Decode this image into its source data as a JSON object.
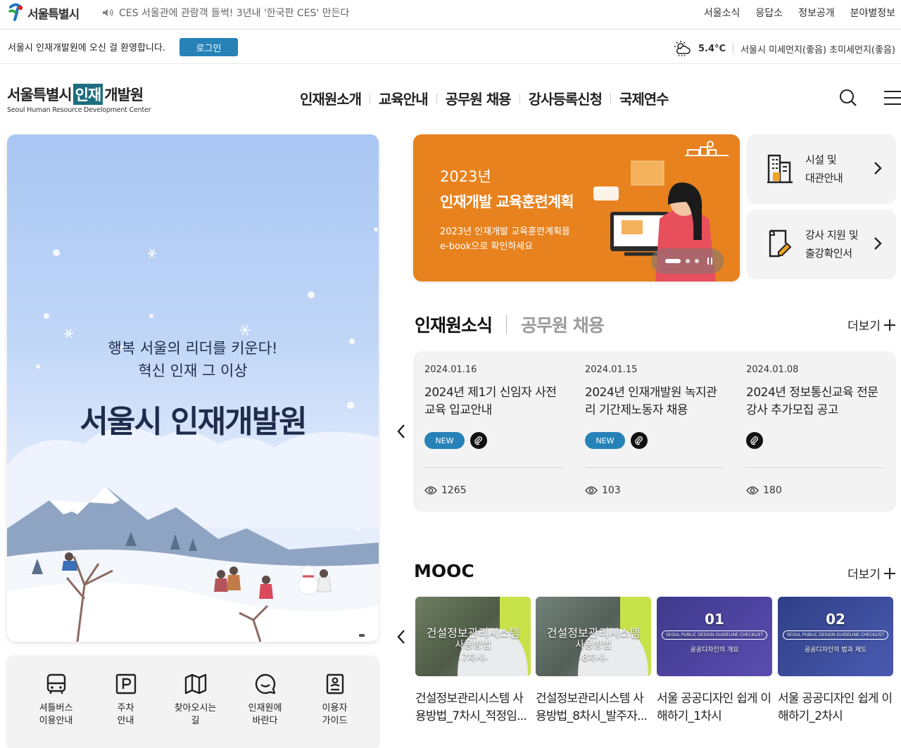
{
  "top": {
    "logo_text": "서울특별시",
    "news_ticker": "CES 서울관에 관람객 들썩! 3년내 '한국판 CES' 만든다",
    "links": [
      "서울소식",
      "응답소",
      "정보공개",
      "분야별정보"
    ]
  },
  "welcome": {
    "message": "서울시 인재개발원에 오신 걸 환영합니다.",
    "login_label": "로그인",
    "temperature": "5.4°C",
    "air_quality": "서울시 미세먼지(좋음) 초미세먼지(좋음)"
  },
  "brand": {
    "ko_pre": "서울특별시",
    "ko_box": "인재",
    "ko_post": "개발원",
    "en": "Seoul Human Resource Development Center"
  },
  "gnb": [
    "인재원소개",
    "교육안내",
    "공무원 채용",
    "강사등록신청",
    "국제연수"
  ],
  "hero": {
    "line1": "행복 서울의 리더를 키운다!",
    "line2": "혁신 인재 그 이상",
    "title": "서울시 인재개발원"
  },
  "quick_links": [
    "셔틀버스\n이용안내",
    "주차\n안내",
    "찾아오시는\n길",
    "인재원에\n바란다",
    "이용자\n가이드"
  ],
  "banner": {
    "year": "2023년",
    "title": "인재개발 교육훈련계획",
    "desc": "2023년 인재개발 교육훈련계획을\ne-book으로 확인하세요",
    "accent": "#e8821e"
  },
  "side_links": [
    "시설 및\n대관안내",
    "강사 지원 및\n출강확인서"
  ],
  "news": {
    "tab_active": "인재원소식",
    "tab_inactive": "공무원 채용",
    "more_label": "더보기",
    "items": [
      {
        "date": "2024.01.16",
        "title": "2024년 제1기 신임자 사전교육 입교안내",
        "badge": "NEW",
        "views": "1265"
      },
      {
        "date": "2024.01.15",
        "title": "2024년 인재개발원 녹지관리 기간제노동자 채용",
        "badge": "NEW",
        "views": "103"
      },
      {
        "date": "2024.01.08",
        "title": "2024년 정보통신교육 전문강사 추가모집 공고",
        "badge": "",
        "views": "180"
      }
    ]
  },
  "mooc": {
    "title": "MOOC",
    "more_label": "더보기",
    "items": [
      {
        "thumb_title": "건설정보관리시스템",
        "thumb_sub": "사용방법",
        "thumb_no": "-7차시-",
        "caption": "건설정보관리시스템 사용방법_7차시_적정임..."
      },
      {
        "thumb_title": "건설정보관리시스템",
        "thumb_sub": "사용방법",
        "thumb_no": "-8차시-",
        "caption": "건설정보관리시스템 사용방법_8차시_발주자..."
      },
      {
        "thumb_no": "01",
        "thumb_tag": "SEOUL PUBLIC DESIGN GUIDELINE CHECKLIST",
        "thumb_sub": "공공디자인의 개요",
        "caption": "서울 공공디자인 쉽게 이해하기_1차시"
      },
      {
        "thumb_no": "02",
        "thumb_tag": "SEOUL PUBLIC DESIGN GUIDELINE CHECKLIST",
        "thumb_sub": "공공디자인의 법과 제도",
        "caption": "서울 공공디자인 쉽게 이해하기_2차시"
      }
    ]
  }
}
